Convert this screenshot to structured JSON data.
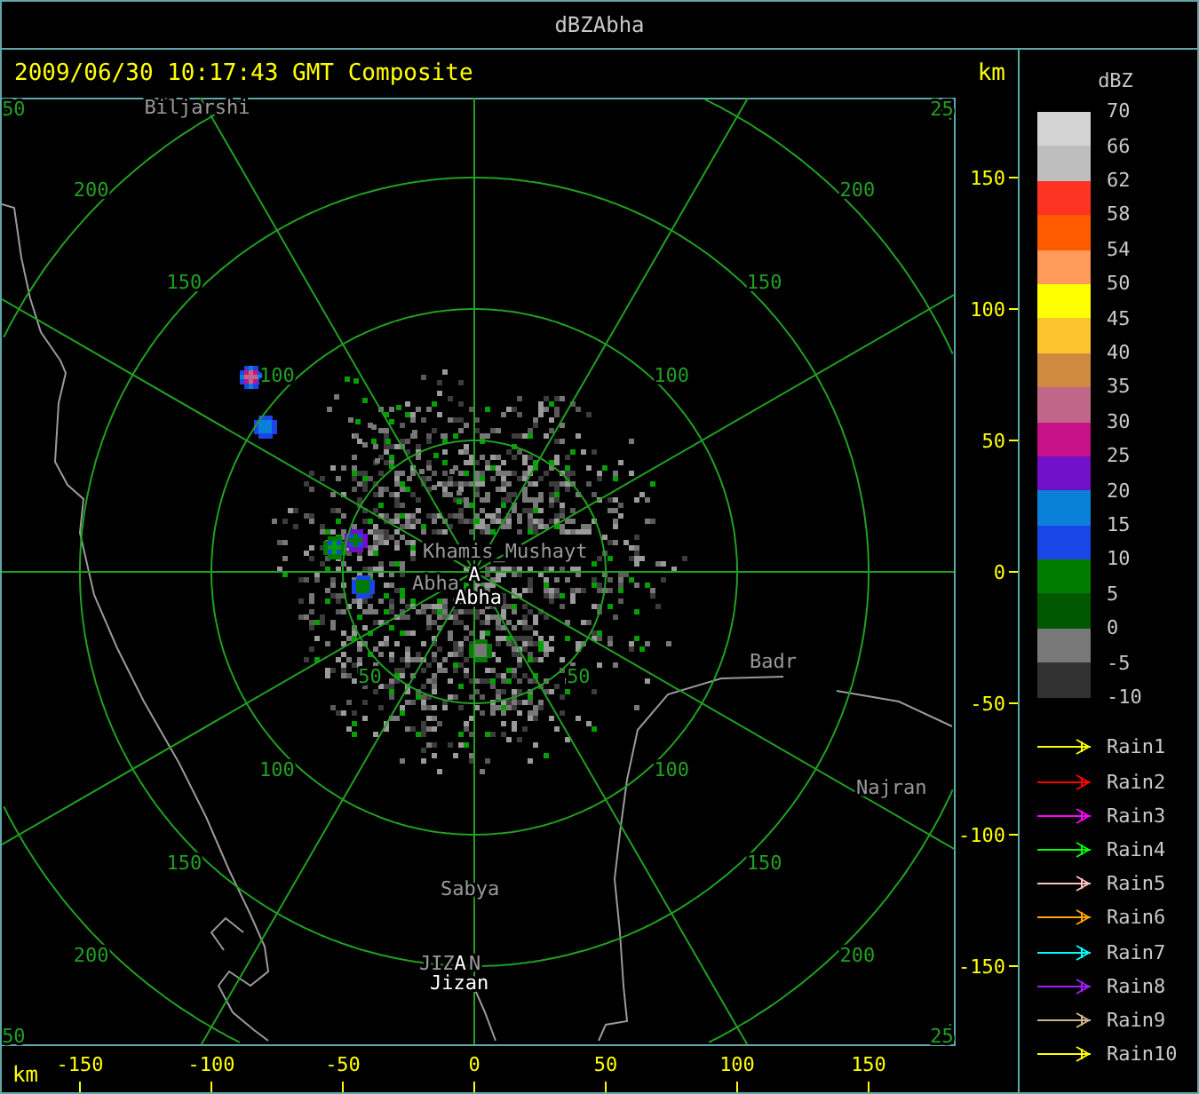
{
  "window": {
    "title": "dBZAbha"
  },
  "header": {
    "timestamp": "2009/06/30 10:17:43 GMT Composite",
    "unit": "km"
  },
  "map": {
    "rings": [
      {
        "labels": [
          "50",
          "50"
        ]
      },
      {
        "labels": [
          "100",
          "100",
          "100",
          "100"
        ]
      },
      {
        "labels": [
          "150",
          "150",
          "150",
          "150"
        ]
      },
      {
        "labels": [
          "200",
          "200",
          "200",
          "200"
        ]
      },
      {
        "labels": [
          "50",
          "25",
          "50",
          "25"
        ]
      }
    ],
    "places": [
      {
        "name": "Biljarshi",
        "kind": "town"
      },
      {
        "name": "Khamis_Mushayt",
        "kind": "town"
      },
      {
        "name": "Abha",
        "kind": "town"
      },
      {
        "name": "A",
        "kind": "marker"
      },
      {
        "name": "Abha",
        "kind": "station"
      },
      {
        "name": "Badr",
        "kind": "town"
      },
      {
        "name": "Najran",
        "kind": "town"
      },
      {
        "name": "Sabya",
        "kind": "town"
      },
      {
        "name": "JIZ",
        "kind": "town"
      },
      {
        "name": "A",
        "kind": "marker"
      },
      {
        "name": "N",
        "kind": "town"
      },
      {
        "name": "Jizan",
        "kind": "station"
      }
    ]
  },
  "x_axis": {
    "unit": "km",
    "ticks": [
      "-150",
      "-100",
      "-50",
      "0",
      "50",
      "100",
      "150"
    ]
  },
  "y_axis": {
    "ticks": [
      "150",
      "100",
      "50",
      "0",
      "-50",
      "-100",
      "-150"
    ]
  },
  "legend": {
    "title": "dBZ",
    "labels": [
      "70",
      "66",
      "62",
      "58",
      "54",
      "50",
      "45",
      "40",
      "35",
      "30",
      "25",
      "20",
      "15",
      "10",
      "5",
      "0",
      "-5",
      "-10"
    ],
    "bands": [
      {
        "color": "#d4d4d4"
      },
      {
        "color": "#bebebe"
      },
      {
        "color": "#ff3322"
      },
      {
        "color": "#ff5a00"
      },
      {
        "color": "#ff9a5a"
      },
      {
        "color": "#ffff00"
      },
      {
        "color": "#fcc52f"
      },
      {
        "color": "#d08a40"
      },
      {
        "color": "#c06688"
      },
      {
        "color": "#c8128a"
      },
      {
        "color": "#7010c8"
      },
      {
        "color": "#0a80d8"
      },
      {
        "color": "#1a46e8"
      },
      {
        "color": "#007c00"
      },
      {
        "color": "#005800"
      },
      {
        "color": "#787878"
      },
      {
        "color": "#323232"
      }
    ]
  },
  "rain_legend": [
    {
      "label": "Rain1",
      "color": "#ffff00"
    },
    {
      "label": "Rain2",
      "color": "#ff0000"
    },
    {
      "label": "Rain3",
      "color": "#ff00ff"
    },
    {
      "label": "Rain4",
      "color": "#00ff00"
    },
    {
      "label": "Rain5",
      "color": "#ffc0c0"
    },
    {
      "label": "Rain6",
      "color": "#ffa500"
    },
    {
      "label": "Rain7",
      "color": "#00ffff"
    },
    {
      "label": "Rain8",
      "color": "#a020f0"
    },
    {
      "label": "Rain9",
      "color": "#d2b48c"
    },
    {
      "label": "Rain10",
      "color": "#ffff00"
    }
  ]
}
